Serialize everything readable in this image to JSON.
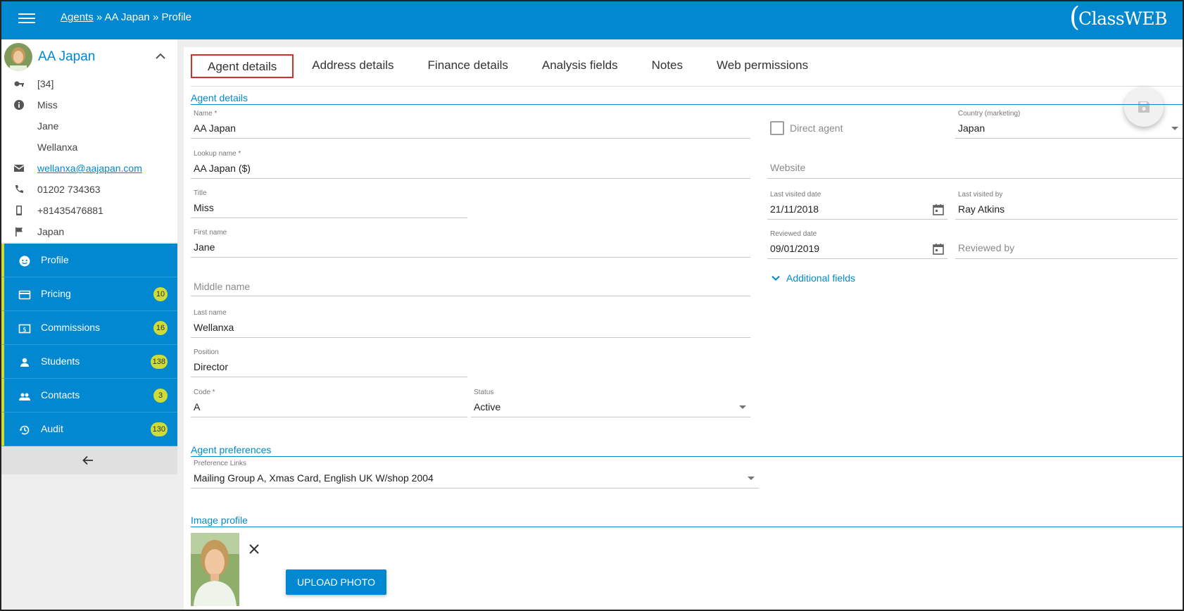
{
  "header": {
    "crumb_link": "Agents",
    "crumb_rest": " » AA Japan » Profile",
    "logo_text": "ClassWEB"
  },
  "agent": {
    "name": "AA Japan",
    "info": [
      {
        "icon": "key-icon",
        "text": "[34]"
      },
      {
        "icon": "info-icon",
        "text": "Miss"
      },
      {
        "icon": "",
        "text": "Jane"
      },
      {
        "icon": "",
        "text": "Wellanxa"
      },
      {
        "icon": "email-icon",
        "text": "wellanxa@aajapan.com"
      },
      {
        "icon": "phone-icon",
        "text": "01202 734363"
      },
      {
        "icon": "mobile-icon",
        "text": "+81435476881"
      },
      {
        "icon": "flag-icon",
        "text": "Japan"
      }
    ]
  },
  "nav": [
    {
      "label": "Profile",
      "icon": "face-icon",
      "badge": ""
    },
    {
      "label": "Pricing",
      "icon": "card-icon",
      "badge": "10"
    },
    {
      "label": "Commissions",
      "icon": "money-icon",
      "badge": "16"
    },
    {
      "label": "Students",
      "icon": "person-icon",
      "badge": "138"
    },
    {
      "label": "Contacts",
      "icon": "people-icon",
      "badge": "3"
    },
    {
      "label": "Audit",
      "icon": "history-icon",
      "badge": "130"
    }
  ],
  "tabs": [
    "Agent details",
    "Address details",
    "Finance details",
    "Analysis fields",
    "Notes",
    "Web permissions"
  ],
  "sections": {
    "agent_details": "Agent details",
    "agent_preferences": "Agent preferences",
    "image_profile": "Image profile"
  },
  "fields": {
    "name": {
      "label": "Name *",
      "value": "AA Japan"
    },
    "lookup_name": {
      "label": "Lookup name *",
      "value": "AA Japan ($)"
    },
    "title": {
      "label": "Title",
      "value": "Miss"
    },
    "first_name": {
      "label": "First name",
      "value": "Jane"
    },
    "middle_name": {
      "placeholder": "Middle name"
    },
    "last_name": {
      "label": "Last name",
      "value": "Wellanxa"
    },
    "position": {
      "label": "Position",
      "value": "Director"
    },
    "code": {
      "label": "Code *",
      "value": "A"
    },
    "status": {
      "label": "Status",
      "value": "Active"
    },
    "direct_agent": {
      "label": "Direct agent",
      "checked": false
    },
    "country_marketing": {
      "label": "Country (marketing)",
      "value": "Japan"
    },
    "website": {
      "placeholder": "Website"
    },
    "last_visited_date": {
      "label": "Last visited date",
      "value": "21/11/2018"
    },
    "last_visited_by": {
      "label": "Last visited by",
      "value": "Ray Atkins"
    },
    "reviewed_date": {
      "label": "Reviewed date",
      "value": "09/01/2019"
    },
    "reviewed_by": {
      "placeholder": "Reviewed by"
    },
    "preference_links": {
      "label": "Preference Links",
      "value": "Mailing Group A, Xmas Card, English UK W/shop 2004"
    }
  },
  "additional_fields": "Additional fields",
  "upload_label": "UPLOAD PHOTO",
  "colors": {
    "primary": "#0288d1",
    "badge": "#cddc39",
    "active_tab_border": "#d32f2f"
  }
}
